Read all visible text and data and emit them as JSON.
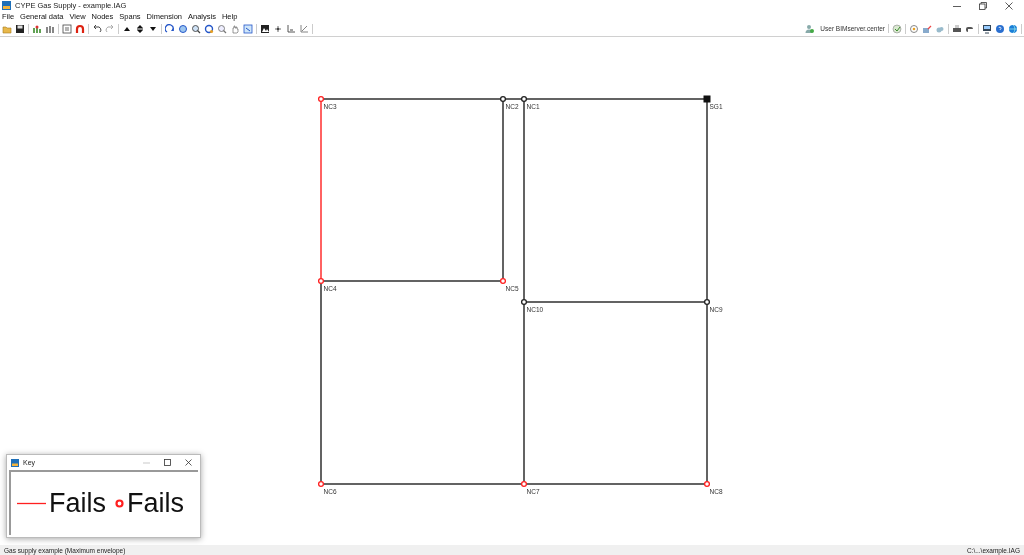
{
  "window": {
    "title": "CYPE Gas Supply - example.IAG"
  },
  "menu": [
    "File",
    "General data",
    "View",
    "Nodes",
    "Spans",
    "Dimension",
    "Analysis",
    "Help"
  ],
  "toolbar": {
    "user_label": "User BIMserver.center"
  },
  "network": {
    "nodes": [
      {
        "label": "NC3",
        "kind": "consumption",
        "fails": true
      },
      {
        "label": "NC2",
        "kind": "consumption",
        "fails": false
      },
      {
        "label": "NC1",
        "kind": "consumption",
        "fails": false
      },
      {
        "label": "SG1",
        "kind": "supply",
        "fails": false
      },
      {
        "label": "NC4",
        "kind": "consumption",
        "fails": true
      },
      {
        "label": "NC5",
        "kind": "consumption",
        "fails": true
      },
      {
        "label": "NC10",
        "kind": "consumption",
        "fails": false
      },
      {
        "label": "NC9",
        "kind": "consumption",
        "fails": false
      },
      {
        "label": "NC6",
        "kind": "consumption",
        "fails": true
      },
      {
        "label": "NC7",
        "kind": "consumption",
        "fails": true
      },
      {
        "label": "NC8",
        "kind": "consumption",
        "fails": true
      }
    ],
    "spans": [
      {
        "fails": false
      },
      {
        "fails": false
      },
      {
        "fails": false
      },
      {
        "fails": true
      },
      {
        "fails": false
      },
      {
        "fails": false
      },
      {
        "fails": false
      },
      {
        "fails": false
      },
      {
        "fails": false
      },
      {
        "fails": false
      },
      {
        "fails": false
      },
      {
        "fails": false
      },
      {
        "fails": false
      },
      {
        "fails": false
      }
    ]
  },
  "key_window": {
    "title": "Key",
    "entries": [
      {
        "kind": "span",
        "label": "Fails"
      },
      {
        "kind": "node",
        "label": "Fails"
      }
    ]
  },
  "status_bar": {
    "left": "Gas supply example (Maximum envelope)",
    "right": "C:\\...\\example.IAG"
  }
}
